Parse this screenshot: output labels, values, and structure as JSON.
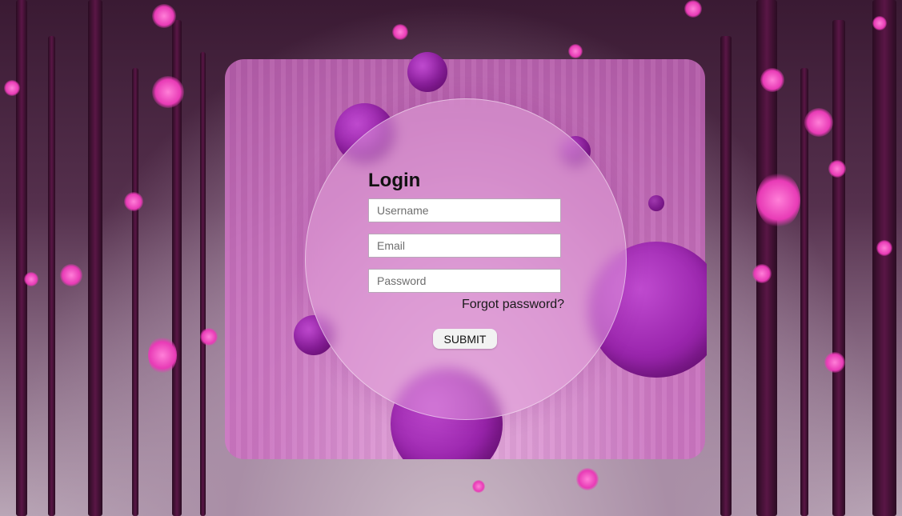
{
  "login": {
    "title": "Login",
    "username_placeholder": "Username",
    "email_placeholder": "Email",
    "password_placeholder": "Password",
    "forgot_label": "Forgot password?",
    "submit_label": "SUBMIT"
  },
  "colors": {
    "card": "#d46ec8",
    "orb": "#9a25ad",
    "bokeh": "#e83bb6",
    "trunk": "#5a1646"
  }
}
